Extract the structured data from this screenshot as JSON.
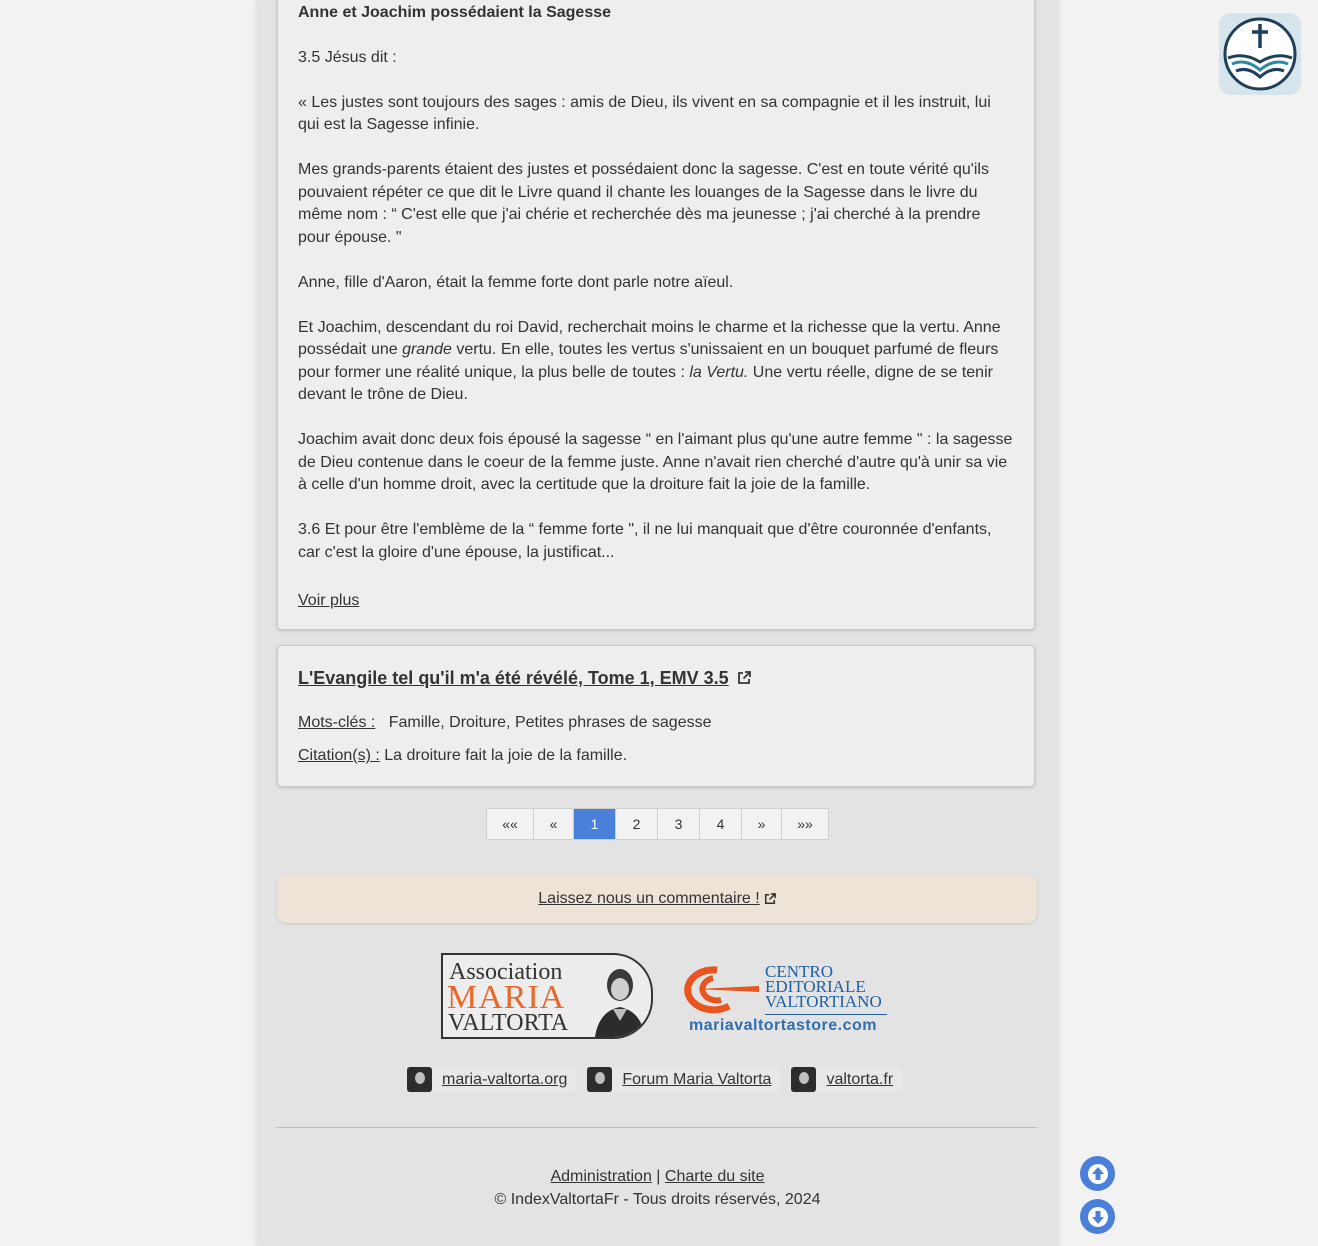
{
  "article": {
    "heading": "Anne et Joachim possédaient la Sagesse",
    "p1": "3.5 Jésus dit :",
    "p2": "« Les justes sont toujours des sages : amis de Dieu, ils vivent en sa compagnie et il les instruit, lui qui est la Sagesse infinie.",
    "p3": "Mes grands-parents étaient des justes et possédaient donc la sagesse. C'est en toute vérité qu'ils pouvaient répéter ce que dit le Livre quand il chante les louanges de la Sagesse dans le livre du même nom : “ C'est elle que j'ai chérie et recherchée dès ma jeunesse ; j'ai cherché à la prendre pour épouse. \"",
    "p4": "Anne, fille d'Aaron, était la femme forte dont parle notre aïeul.",
    "p5a": "Et Joachim, descendant du roi David, recherchait moins le charme et la richesse que la vertu. Anne possédait une ",
    "p5b": "grande",
    "p5c": " vertu. En elle, toutes les vertus s'unissaient en un bouquet parfumé de fleurs pour former une réalité unique, la plus belle de toutes : ",
    "p5d": "la Vertu.",
    "p5e": " Une vertu réelle, digne de se tenir devant le trône de Dieu.",
    "p6": "Joachim avait donc deux fois épousé la sagesse “ en l'aimant plus qu'une autre femme \" : la sagesse de Dieu contenue dans le coeur de la femme juste. Anne n'avait rien cherché d'autre qu'à unir sa vie à celle d'un homme droit, avec la certitude que la droiture fait la joie de la famille.",
    "p7": "3.6 Et pour être l'emblème de la “ femme forte \", il ne lui manquait que d'être couronnée d'enfants, car c'est la gloire d'une épouse, la justificat...",
    "more_link": "Voir plus"
  },
  "source": {
    "title": "L'Evangile tel qu'il m'a été révélé, Tome 1, EMV 3.5",
    "keywords_label": "Mots-clés :",
    "keywords": "Famille, Droiture, Petites phrases de sagesse",
    "citation_label": "Citation(s) :",
    "citation": "La droiture fait la joie de la famille."
  },
  "pagination": {
    "first": "««",
    "prev": "«",
    "pages": [
      "1",
      "2",
      "3",
      "4"
    ],
    "active_page": "1",
    "next": "»",
    "last": "»»"
  },
  "comment_link": "Laissez nous un commentaire !",
  "logos": {
    "association_line1": "Association",
    "association_line2": "MARIA",
    "association_line3": "VALTORTA",
    "cev_line1": "CENTRO",
    "cev_line2": "EDITORIALE",
    "cev_line3": "VALTORTIANO",
    "cev_url": "mariavaltortastore.com"
  },
  "external_links": [
    "maria-valtorta.org",
    "Forum Maria Valtorta",
    "valtorta.fr"
  ],
  "footer": {
    "admin": "Administration",
    "separator": "|",
    "charter": "Charte du site",
    "copyright": "© IndexValtortaFr - Tous droits réservés, 2024"
  },
  "colors": {
    "accent": "#4a80d9",
    "comment_bg": "#ede3d6",
    "brand_orange": "#e8672b",
    "brand_blue": "#1f5fa6"
  },
  "icons": [
    "external-link-icon",
    "arrow-up-icon",
    "arrow-down-icon",
    "bible-cross-logo-icon"
  ]
}
